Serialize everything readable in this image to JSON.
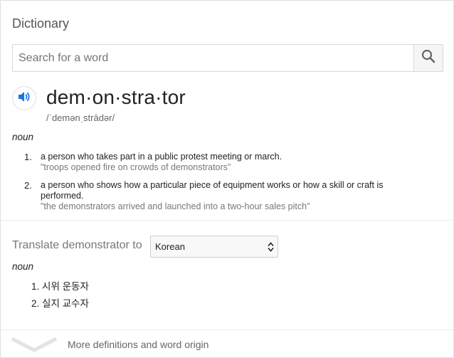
{
  "header": {
    "title": "Dictionary"
  },
  "search": {
    "placeholder": "Search for a word",
    "value": "",
    "button_icon": "search-icon"
  },
  "entry": {
    "word": "dem·on·stra·tor",
    "phonetic": "/ˈdemənˌstrādər/",
    "part_of_speech": "noun",
    "definitions": [
      {
        "number": "1.",
        "text": "a person who takes part in a public protest meeting or march.",
        "example": "\"troops opened fire on crowds of demonstrators\""
      },
      {
        "number": "2.",
        "text": "a person who shows how a particular piece of equipment works or how a skill or craft is performed.",
        "example": "\"the demonstrators arrived and launched into a two-hour sales pitch\""
      }
    ]
  },
  "translate": {
    "label": "Translate demonstrator to",
    "language": "Korean",
    "part_of_speech": "noun",
    "items": [
      {
        "number": "1.",
        "text": "시위 운동자"
      },
      {
        "number": "2.",
        "text": "실지 교수자"
      }
    ]
  },
  "footer": {
    "more_label": "More definitions and word origin"
  },
  "colors": {
    "speaker_blue": "#1a73e8",
    "muted_text": "#777777"
  }
}
